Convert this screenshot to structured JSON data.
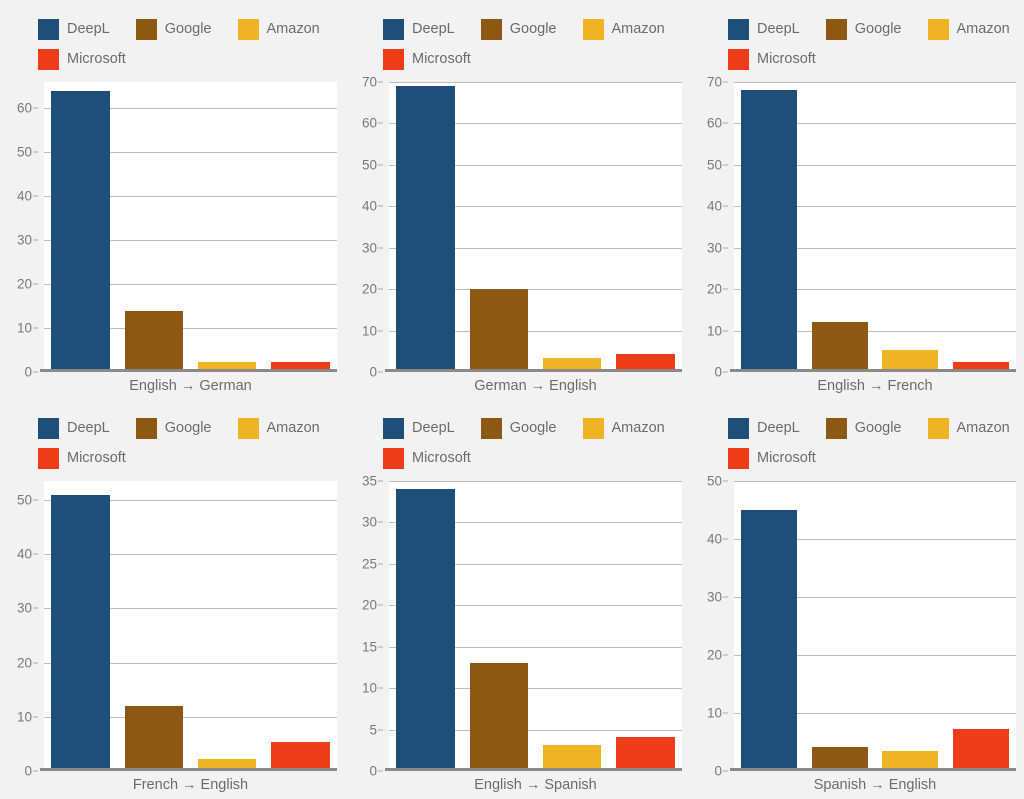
{
  "colors": {
    "background": "#f2f2f2",
    "plot_background": "#ffffff",
    "gridline": "#bdbdbd",
    "axis": "#8a8a8a",
    "text": "#6b6b6b",
    "DeepL": "#1f4e79",
    "Google": "#8c5814",
    "Amazon": "#f0b323",
    "Microsoft": "#ee3b18"
  },
  "legend": {
    "items": [
      {
        "label": "DeepL",
        "color": "#1f4e79"
      },
      {
        "label": "Google",
        "color": "#8c5814"
      },
      {
        "label": "Amazon",
        "color": "#f0b323"
      },
      {
        "label": "Microsoft",
        "color": "#ee3b18"
      }
    ]
  },
  "chart_data": [
    {
      "type": "bar",
      "title": "English → German",
      "xlabel": "English → German",
      "ylabel": "",
      "categories": [
        "DeepL",
        "Google",
        "Amazon",
        "Microsoft"
      ],
      "values": [
        64,
        14,
        2.2,
        2.3
      ],
      "colors": [
        "#1f4e79",
        "#8c5814",
        "#f0b323",
        "#ee3b18"
      ],
      "yticks": [
        0,
        10,
        20,
        30,
        40,
        50,
        60
      ],
      "ylim": [
        0,
        66
      ],
      "grid": true,
      "legend_position": "top-left"
    },
    {
      "type": "bar",
      "title": "German → English",
      "xlabel": "German → English",
      "ylabel": "",
      "categories": [
        "DeepL",
        "Google",
        "Amazon",
        "Microsoft"
      ],
      "values": [
        69,
        20,
        3.4,
        4.3
      ],
      "colors": [
        "#1f4e79",
        "#8c5814",
        "#f0b323",
        "#ee3b18"
      ],
      "yticks": [
        0,
        10,
        20,
        30,
        40,
        50,
        60,
        70
      ],
      "ylim": [
        0,
        70
      ],
      "grid": true,
      "legend_position": "top-left"
    },
    {
      "type": "bar",
      "title": "English → French",
      "xlabel": "English → French",
      "ylabel": "",
      "categories": [
        "DeepL",
        "Google",
        "Amazon",
        "Microsoft"
      ],
      "values": [
        68,
        12,
        5.3,
        2.3
      ],
      "colors": [
        "#1f4e79",
        "#8c5814",
        "#f0b323",
        "#ee3b18"
      ],
      "yticks": [
        0,
        10,
        20,
        30,
        40,
        50,
        60,
        70
      ],
      "ylim": [
        0,
        70
      ],
      "grid": true,
      "legend_position": "top-left"
    },
    {
      "type": "bar",
      "title": "French → English",
      "xlabel": "French → English",
      "ylabel": "",
      "categories": [
        "DeepL",
        "Google",
        "Amazon",
        "Microsoft"
      ],
      "values": [
        51,
        12,
        2.2,
        5.3
      ],
      "colors": [
        "#1f4e79",
        "#8c5814",
        "#f0b323",
        "#ee3b18"
      ],
      "yticks": [
        0,
        10,
        20,
        30,
        40,
        50
      ],
      "ylim": [
        0,
        53.5
      ],
      "grid": true,
      "legend_position": "top-left"
    },
    {
      "type": "bar",
      "title": "English → Spanish",
      "xlabel": "English → Spanish",
      "ylabel": "",
      "categories": [
        "DeepL",
        "Google",
        "Amazon",
        "Microsoft"
      ],
      "values": [
        34,
        13,
        3.1,
        4.1
      ],
      "colors": [
        "#1f4e79",
        "#8c5814",
        "#f0b323",
        "#ee3b18"
      ],
      "yticks": [
        0,
        5,
        10,
        15,
        20,
        25,
        30,
        35
      ],
      "ylim": [
        0,
        35
      ],
      "grid": true,
      "legend_position": "top-left"
    },
    {
      "type": "bar",
      "title": "Spanish → English",
      "xlabel": "Spanish → English",
      "ylabel": "",
      "categories": [
        "DeepL",
        "Google",
        "Amazon",
        "Microsoft"
      ],
      "values": [
        45,
        4.2,
        3.4,
        7.2
      ],
      "colors": [
        "#1f4e79",
        "#8c5814",
        "#f0b323",
        "#ee3b18"
      ],
      "yticks": [
        0,
        10,
        20,
        30,
        40,
        50
      ],
      "ylim": [
        0,
        50
      ],
      "grid": true,
      "legend_position": "top-left"
    }
  ]
}
